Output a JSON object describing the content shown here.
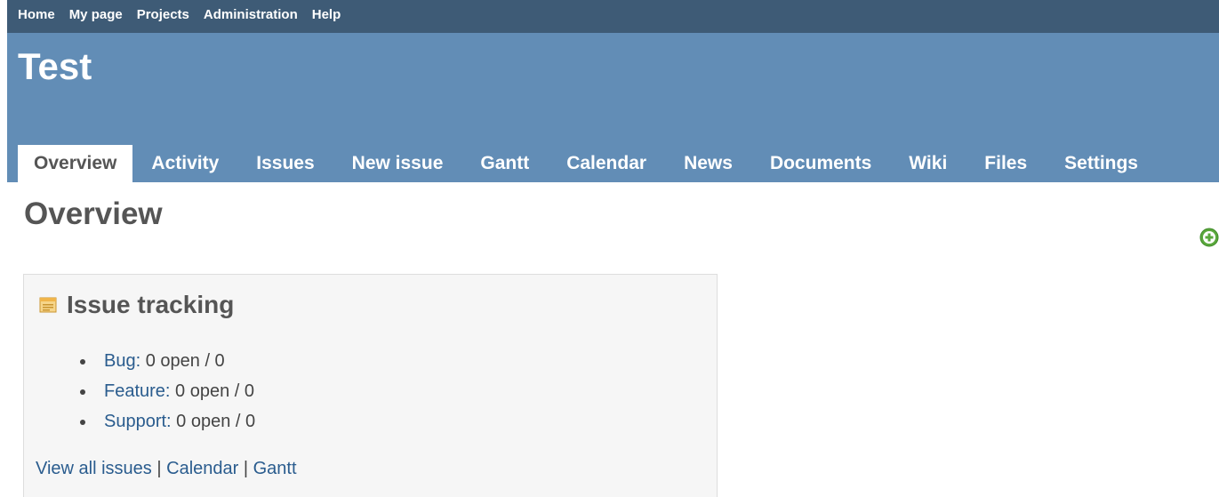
{
  "top_menu": {
    "items": [
      {
        "label": "Home"
      },
      {
        "label": "My page"
      },
      {
        "label": "Projects"
      },
      {
        "label": "Administration"
      },
      {
        "label": "Help"
      }
    ]
  },
  "header": {
    "title": "Test"
  },
  "main_menu": {
    "tabs": [
      {
        "label": "Overview",
        "selected": true
      },
      {
        "label": "Activity"
      },
      {
        "label": "Issues"
      },
      {
        "label": "New issue"
      },
      {
        "label": "Gantt"
      },
      {
        "label": "Calendar"
      },
      {
        "label": "News"
      },
      {
        "label": "Documents"
      },
      {
        "label": "Wiki"
      },
      {
        "label": "Files"
      },
      {
        "label": "Settings"
      }
    ]
  },
  "content": {
    "title": "Overview",
    "add_icon": "plus-circle-icon"
  },
  "issue_tracking": {
    "title": "Issue tracking",
    "icon": "issues-icon",
    "trackers": [
      {
        "name": "Bug:",
        "stats": " 0 open / 0"
      },
      {
        "name": "Feature:",
        "stats": " 0 open / 0"
      },
      {
        "name": "Support:",
        "stats": " 0 open / 0"
      }
    ],
    "links": {
      "view_all": "View all issues",
      "separator": " | ",
      "calendar": "Calendar",
      "gantt": "Gantt"
    }
  },
  "colors": {
    "top_menu_bg": "#3e5b76",
    "header_bg": "#628db6",
    "link": "#2a5c8e",
    "text": "#555555",
    "box_bg": "#f6f6f6"
  }
}
